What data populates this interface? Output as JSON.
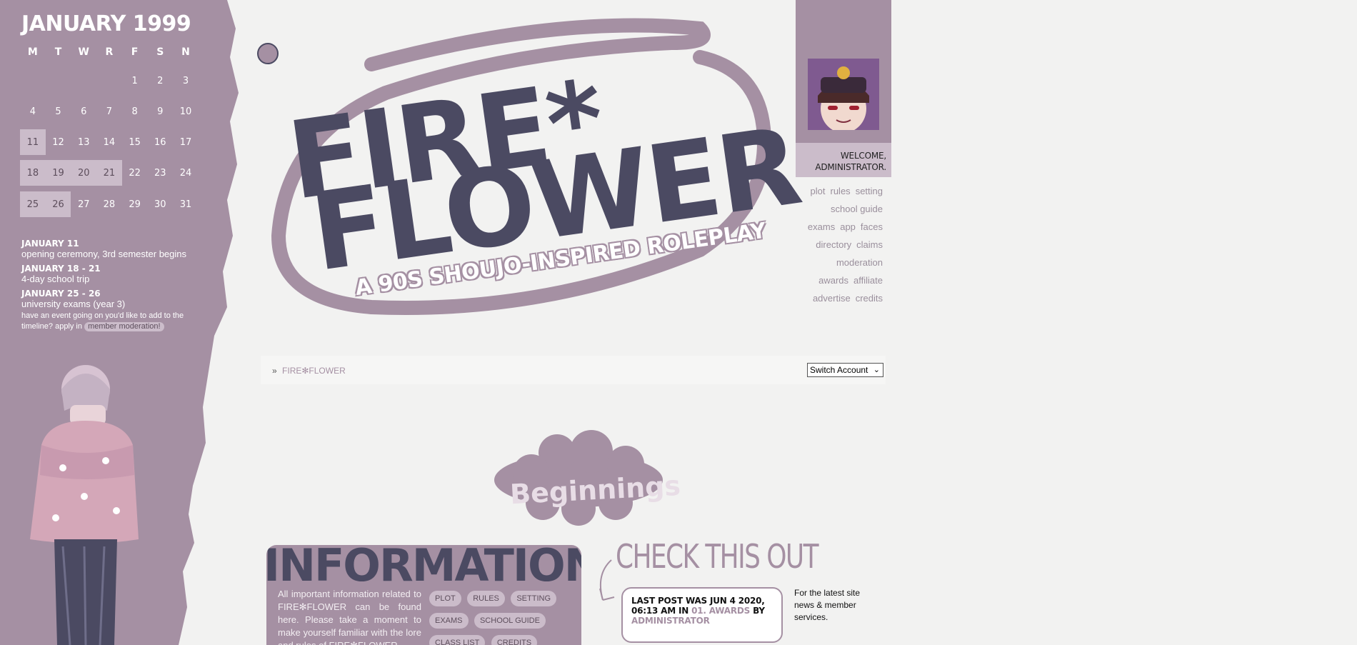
{
  "calendar": {
    "title": "JANUARY 1999",
    "weekdays": [
      "M",
      "T",
      "W",
      "R",
      "F",
      "S",
      "N"
    ],
    "weeks": [
      [
        "",
        "",
        "",
        "",
        "1",
        "2",
        "3"
      ],
      [
        "4",
        "5",
        "6",
        "7",
        "8",
        "9",
        "10"
      ],
      [
        "11",
        "12",
        "13",
        "14",
        "15",
        "16",
        "17"
      ],
      [
        "18",
        "19",
        "20",
        "21",
        "22",
        "23",
        "24"
      ],
      [
        "25",
        "26",
        "27",
        "28",
        "29",
        "30",
        "31"
      ]
    ],
    "highlighted": [
      "11",
      "18",
      "19",
      "20",
      "21",
      "25",
      "26"
    ]
  },
  "events": [
    {
      "date": "JANUARY 11",
      "desc": "opening ceremony, 3rd semester begins"
    },
    {
      "date": "JANUARY 18 - 21",
      "desc": "4-day school trip"
    },
    {
      "date": "JANUARY 25 - 26",
      "desc": "university exams (year 3)"
    }
  ],
  "event_note": {
    "text": "have an event going on you'd like to add to the timeline? apply in",
    "link": "member moderation!"
  },
  "logo": {
    "line1": "FIRE*",
    "line2": "FLOWER",
    "subtitle": "A 90S SHOUJO-INSPIRED ROLEPLAY"
  },
  "user": {
    "welcome_line1": "WELCOME,",
    "welcome_line2": "ADMINISTRATOR."
  },
  "nav": [
    [
      "plot",
      "rules",
      "setting"
    ],
    [
      "school guide"
    ],
    [
      "exams",
      "app",
      "faces"
    ],
    [
      "directory",
      "claims"
    ],
    [
      "moderation"
    ],
    [
      "awards",
      "affiliate"
    ],
    [
      "advertise",
      "credits"
    ]
  ],
  "breadcrumb": {
    "sep": "»",
    "link": "FIRE✻FLOWER"
  },
  "switch_account": {
    "label": "Switch Account"
  },
  "category": {
    "title": "Beginnings"
  },
  "information": {
    "title": "INFORMATION",
    "text": "All important information related to FIRE✻FLOWER can be found here. Please take a moment to make yourself familiar with the lore and rules of FIRE✻FLOWER",
    "tags": [
      "PLOT",
      "RULES",
      "SETTING",
      "EXAMS",
      "SCHOOL GUIDE",
      "CLASS LIST",
      "CREDITS"
    ]
  },
  "check_out": {
    "title": "CHECK THIS OUT",
    "post_prefix": "LAST POST WAS JUN 4 2020, 06:13 AM IN",
    "post_forum": "01. AWARDS",
    "post_by": "BY",
    "post_author": "ADMINISTRATOR",
    "side_note": "For the latest site news & member services."
  },
  "colors": {
    "accent": "#a590a3",
    "dark": "#4b4a62",
    "light_accent": "#cbbcca",
    "background": "#f2f2f1"
  }
}
